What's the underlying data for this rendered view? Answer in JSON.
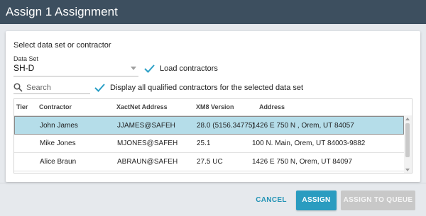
{
  "window": {
    "title": "Assign 1 Assignment"
  },
  "form": {
    "section_title": "Select data set or contractor",
    "data_set_label": "Data Set",
    "data_set_value": "SH-D",
    "load_contractors_label": "Load contractors",
    "display_all_label": "Display all qualified contractors for the selected data set",
    "search_placeholder": "Search"
  },
  "table": {
    "columns": [
      "Tier",
      "Contractor",
      "XactNet Address",
      "XM8 Version",
      "Address"
    ],
    "rows": [
      {
        "tier": "",
        "contractor": "John James",
        "xactnet": "JJAMES@SAFEH",
        "xm8": "28.0 (5156.34775)",
        "address": "1426 E 750 N , Orem, UT 84057",
        "selected": true
      },
      {
        "tier": "",
        "contractor": "Mike Jones",
        "xactnet": "MJONES@SAFEH",
        "xm8": "25.1",
        "address": "100 N. Main, Orem, UT 84003-9882",
        "selected": false
      },
      {
        "tier": "",
        "contractor": "Alice Braun",
        "xactnet": "ABRAUN@SAFEH",
        "xm8": "27.5 UC",
        "address": "1426 E 750 N, Orem, UT 84097",
        "selected": false
      }
    ]
  },
  "buttons": {
    "cancel": "CANCEL",
    "assign": "ASSIGN",
    "assign_to_queue": "ASSIGN TO QUEUE"
  },
  "colors": {
    "titlebar": "#3d4f5f",
    "accent": "#2a9cc0",
    "selected_row": "#b5dde9",
    "check": "#2b9fc6"
  },
  "icons": [
    "checkmark-icon",
    "search-icon",
    "chevron-down-icon"
  ]
}
